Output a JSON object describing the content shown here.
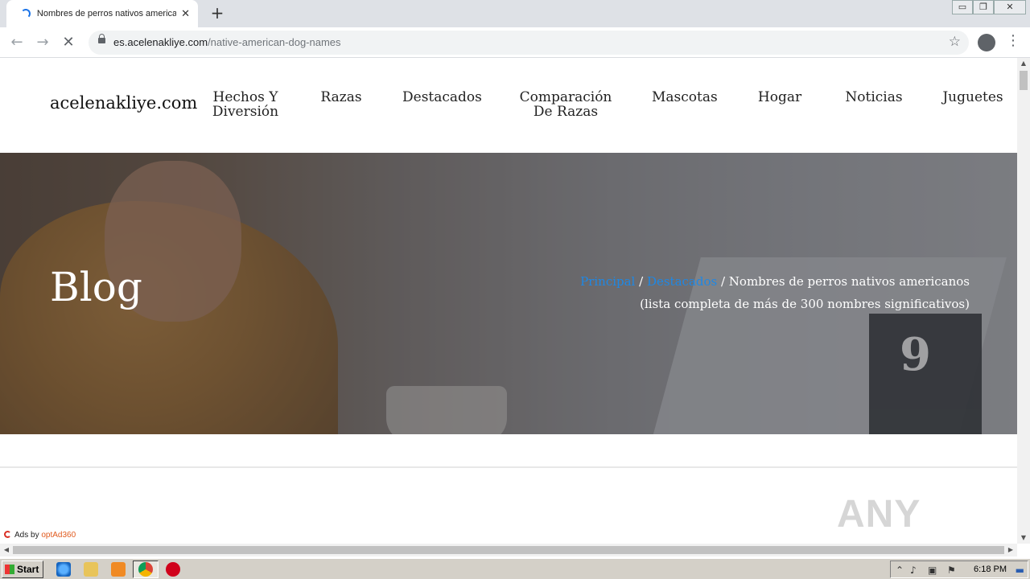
{
  "browser": {
    "tab_title": "Nombres de perros nativos americanos",
    "tab_close": "✕",
    "new_tab": "+",
    "url_host": "es.acelenakliye.com",
    "url_path": "/native-american-dog-names",
    "back": "←",
    "forward": "→",
    "stop": "✕",
    "bookmark": "☆",
    "menu": "⋮",
    "win_min": "▭",
    "win_restore": "❐",
    "win_close": "✕"
  },
  "site": {
    "logo": "acelenakliye.com",
    "nav": [
      {
        "label": "Hechos Y Diversión"
      },
      {
        "label": "Razas"
      },
      {
        "label": "Destacados"
      },
      {
        "label": "Comparación De Razas"
      },
      {
        "label": "Mascotas"
      },
      {
        "label": "Hogar"
      },
      {
        "label": "Noticias"
      },
      {
        "label": "Juguetes"
      }
    ]
  },
  "hero": {
    "title": "Blog",
    "card_number": "9",
    "breadcrumb": {
      "home": "Principal",
      "sep": " / ",
      "category": "Destacados",
      "current": "Nombres de perros nativos americanos (lista completa de más de 300 nombres significativos)"
    }
  },
  "ads": {
    "prefix": "Ads by ",
    "brand": "optAd360"
  },
  "watermark": "ANY RUN",
  "taskbar": {
    "start": "Start",
    "clock": "6:18 PM"
  }
}
